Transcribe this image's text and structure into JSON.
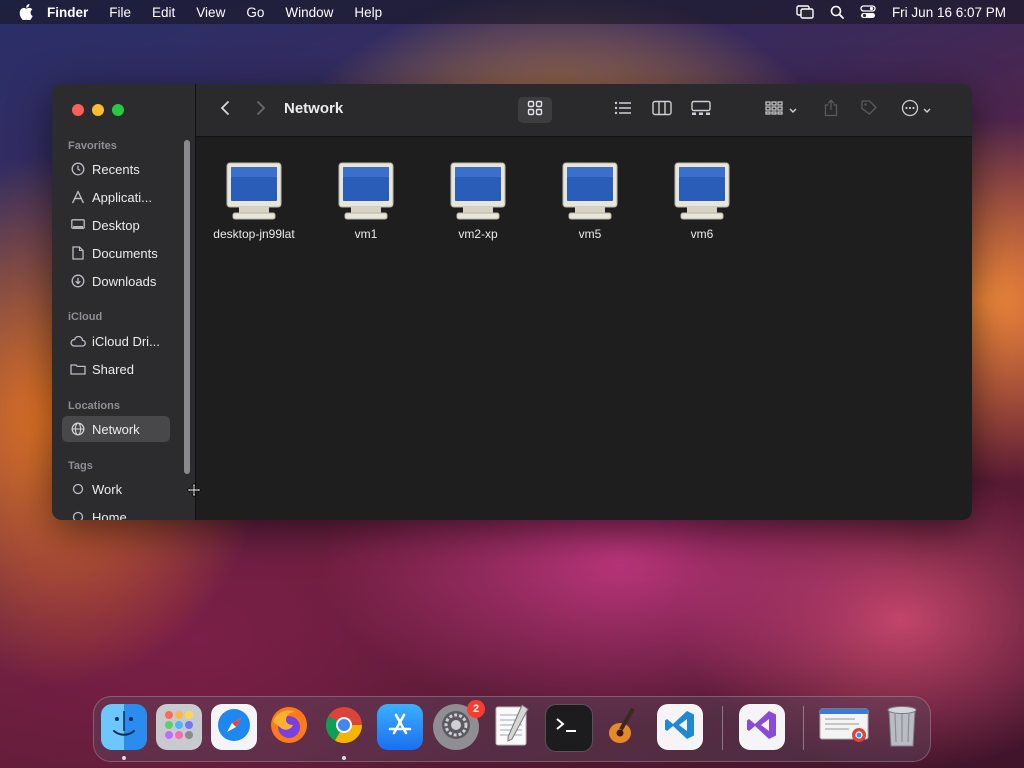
{
  "menubar": {
    "app_name": "Finder",
    "items": [
      "File",
      "Edit",
      "View",
      "Go",
      "Window",
      "Help"
    ],
    "clock": "Fri Jun 16  6:07 PM",
    "status_icons": [
      "screen-mirroring-icon",
      "spotlight-search-icon",
      "control-center-icon"
    ]
  },
  "finder": {
    "title": "Network",
    "sidebar": {
      "favorites_header": "Favorites",
      "favorites": [
        {
          "label": "Recents",
          "icon": "clock-icon"
        },
        {
          "label": "Applicati...",
          "icon": "applications-icon"
        },
        {
          "label": "Desktop",
          "icon": "desktop-icon"
        },
        {
          "label": "Documents",
          "icon": "document-icon"
        },
        {
          "label": "Downloads",
          "icon": "download-icon"
        }
      ],
      "icloud_header": "iCloud",
      "icloud": [
        {
          "label": "iCloud Dri...",
          "icon": "cloud-icon"
        },
        {
          "label": "Shared",
          "icon": "shared-folder-icon"
        }
      ],
      "locations_header": "Locations",
      "locations": [
        {
          "label": "Network",
          "icon": "globe-icon",
          "selected": true
        }
      ],
      "tags_header": "Tags",
      "tags": [
        {
          "label": "Work",
          "icon": "tag-circle-icon"
        },
        {
          "label": "Home",
          "icon": "tag-circle-icon"
        }
      ]
    },
    "items": [
      {
        "name": "desktop-jn99lat"
      },
      {
        "name": "vm1"
      },
      {
        "name": "vm2-xp"
      },
      {
        "name": "vm5"
      },
      {
        "name": "vm6"
      }
    ],
    "accent": "#4a90e2"
  },
  "dock": {
    "apps": [
      "Finder",
      "Launchpad",
      "Safari",
      "Firefox",
      "Chrome",
      "App Store",
      "System Settings",
      "TextEdit",
      "Terminal",
      "GarageBand",
      "Visual Studio Code",
      "Visual Studio",
      "Preview",
      "Trash"
    ],
    "settings_badge": "2"
  }
}
